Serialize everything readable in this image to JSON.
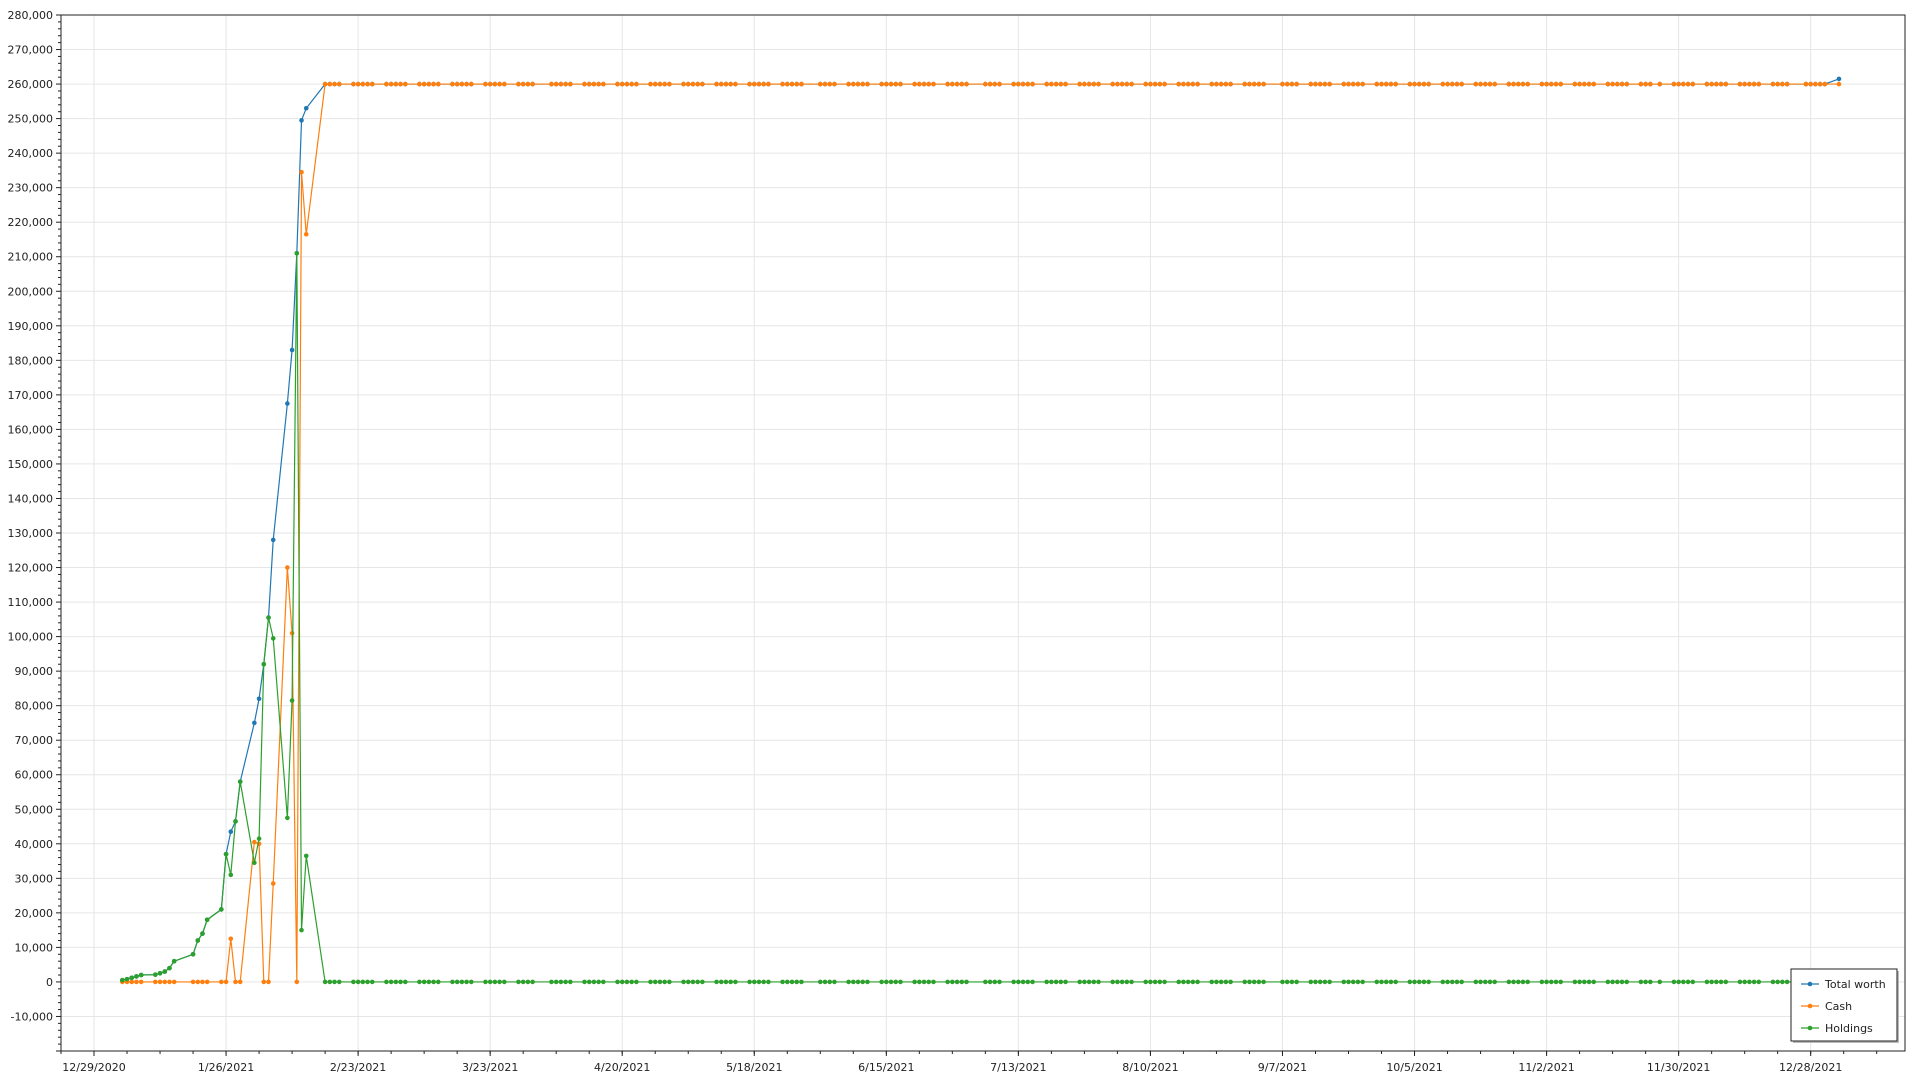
{
  "chart_data": {
    "type": "line",
    "xlabel": "",
    "ylabel": "",
    "x_axis": {
      "type": "date",
      "min": "2020-12-22",
      "max": "2022-01-17",
      "tick_labels": [
        "12/29/2020",
        "1/26/2021",
        "2/23/2021",
        "3/23/2021",
        "4/20/2021",
        "5/18/2021",
        "6/15/2021",
        "7/13/2021",
        "8/10/2021",
        "9/7/2021",
        "10/5/2021",
        "11/2/2021",
        "11/30/2021",
        "12/28/2021"
      ],
      "grid": true
    },
    "y_axis": {
      "min": -20000,
      "max": 280000,
      "tick_step": 10000,
      "tick_labels": [
        "-10,000",
        "0",
        "10,000",
        "20,000",
        "30,000",
        "40,000",
        "50,000",
        "60,000",
        "70,000",
        "80,000",
        "90,000",
        "100,000",
        "110,000",
        "120,000",
        "130,000",
        "140,000",
        "150,000",
        "160,000",
        "170,000",
        "180,000",
        "190,000",
        "200,000",
        "210,000",
        "220,000",
        "230,000",
        "240,000",
        "250,000",
        "260,000",
        "270,000",
        "280,000"
      ],
      "grid": true
    },
    "legend": {
      "position": "bottom-right",
      "entries": [
        "Total worth",
        "Cash",
        "Holdings"
      ]
    },
    "colors": {
      "Total worth": "#1f77b4",
      "Cash": "#ff7f0e",
      "Holdings": "#2ca02c"
    },
    "ramp_dates": [
      "2021-01-04",
      "2021-01-05",
      "2021-01-06",
      "2021-01-07",
      "2021-01-08",
      "2021-01-11",
      "2021-01-12",
      "2021-01-13",
      "2021-01-14",
      "2021-01-15",
      "2021-01-19",
      "2021-01-20",
      "2021-01-21",
      "2021-01-22",
      "2021-01-25",
      "2021-01-26",
      "2021-01-27",
      "2021-01-28",
      "2021-01-29",
      "2021-02-01",
      "2021-02-02",
      "2021-02-03",
      "2021-02-04",
      "2021-02-05",
      "2021-02-08",
      "2021-02-09",
      "2021-02-10",
      "2021-02-11",
      "2021-02-12",
      "2021-02-16"
    ],
    "flat_period": {
      "start": "2021-02-17",
      "end": "2021-12-31",
      "total_worth": 260000,
      "cash": 260000,
      "holdings": 0
    },
    "series": [
      {
        "name": "Total worth",
        "ramp_values": [
          500,
          800,
          1200,
          1600,
          2000,
          2100,
          2500,
          3000,
          4000,
          6000,
          8000,
          12000,
          14000,
          18000,
          21000,
          37000,
          43500,
          46500,
          58000,
          75000,
          82000,
          92000,
          105500,
          128000,
          167500,
          183000,
          211000,
          249500,
          253000,
          260000
        ],
        "final_point": {
          "x": "2022-01-03",
          "y": 261500
        }
      },
      {
        "name": "Cash",
        "ramp_values": [
          0,
          0,
          0,
          0,
          0,
          0,
          0,
          0,
          0,
          0,
          0,
          0,
          0,
          0,
          0,
          0,
          12500,
          0,
          0,
          40500,
          40000,
          0,
          0,
          28500,
          120000,
          101000,
          0,
          234500,
          216500,
          260000
        ],
        "final_point": {
          "x": "2022-01-03",
          "y": 260000
        }
      },
      {
        "name": "Holdings",
        "ramp_values": [
          500,
          800,
          1200,
          1600,
          2000,
          2100,
          2500,
          3000,
          4000,
          6000,
          8000,
          12000,
          14000,
          18000,
          21000,
          37000,
          31000,
          46500,
          58000,
          34500,
          41500,
          92000,
          105500,
          99500,
          47500,
          81500,
          211000,
          15000,
          36500,
          0
        ],
        "final_point": {
          "x": "2022-01-03",
          "y": 0
        }
      }
    ]
  }
}
